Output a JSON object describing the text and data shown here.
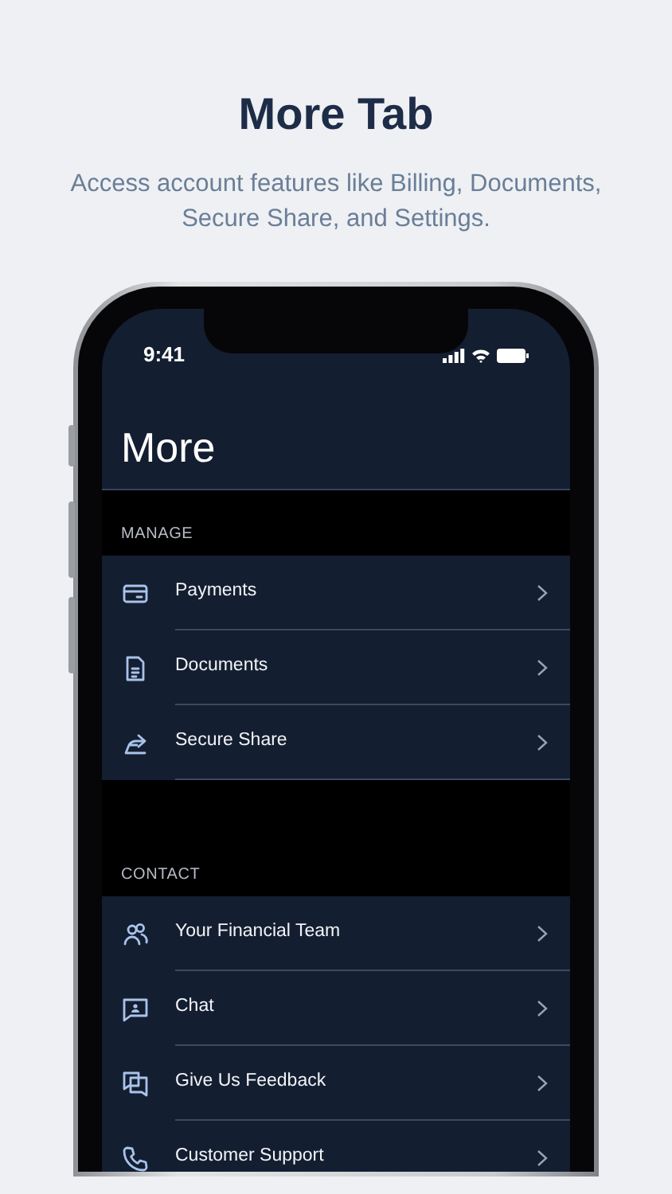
{
  "header": {
    "title": "More Tab",
    "subtitle": "Access account features like Billing, Documents, Secure Share, and Settings."
  },
  "status_bar": {
    "time": "9:41"
  },
  "screen_title": "More",
  "sections": [
    {
      "title": "MANAGE",
      "items": [
        {
          "label": "Payments"
        },
        {
          "label": "Documents"
        },
        {
          "label": "Secure Share"
        }
      ]
    },
    {
      "title": "CONTACT",
      "items": [
        {
          "label": "Your Financial Team"
        },
        {
          "label": "Chat"
        },
        {
          "label": "Give Us Feedback"
        },
        {
          "label": "Customer Support"
        }
      ]
    }
  ]
}
